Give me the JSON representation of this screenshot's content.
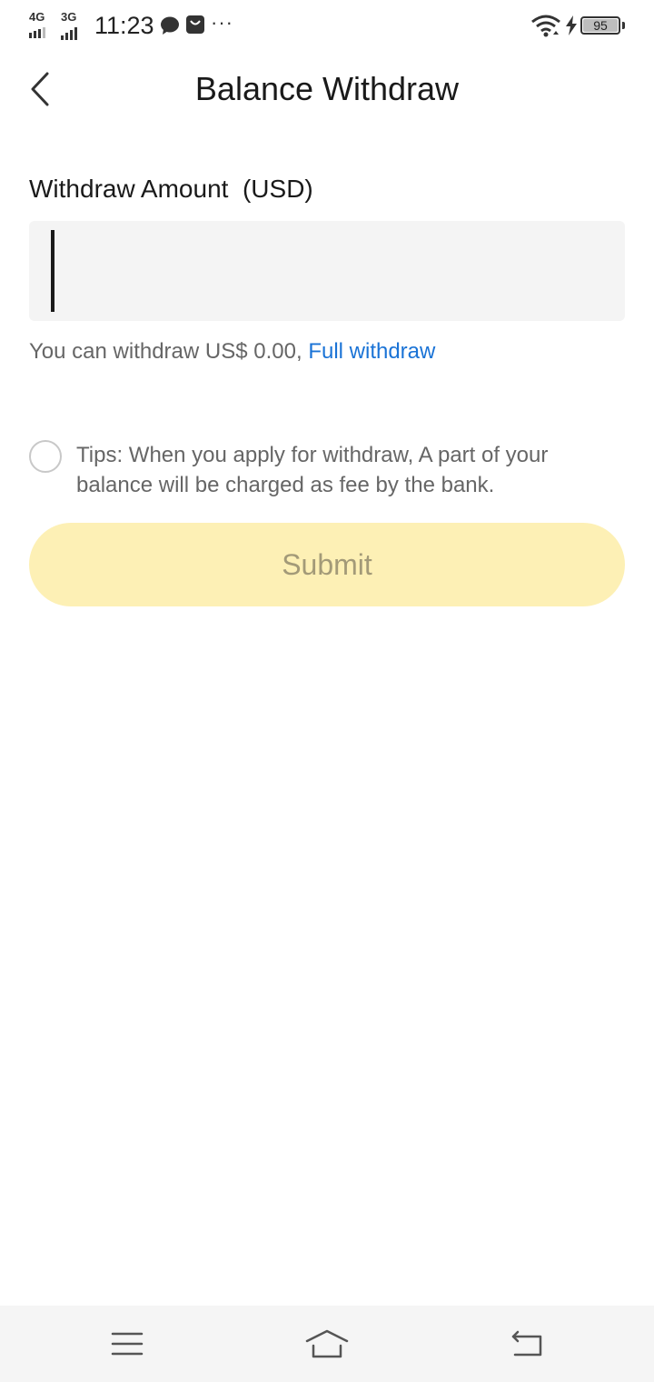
{
  "status_bar": {
    "network_1": "4G",
    "network_2": "3G",
    "time": "11:23",
    "more_indicator": "···",
    "battery_level": "95",
    "icons": [
      "chat-bubble-icon",
      "shopping-bag-icon",
      "wifi-icon",
      "charging-icon",
      "battery-icon"
    ]
  },
  "header": {
    "back_icon": "chevron-left-icon",
    "title": "Balance Withdraw"
  },
  "form": {
    "label": "Withdraw Amount  (USD)",
    "amount_value": "",
    "available_text": "You can withdraw US$ 0.00, ",
    "full_withdraw_link": "Full withdraw",
    "tips": "Tips: When you apply for withdraw, A part of your balance will be charged as fee by the bank.",
    "submit_label": "Submit"
  },
  "colors": {
    "link": "#1a73d6",
    "submit_bg": "#fdf0b5",
    "submit_text": "#a39a78",
    "input_bg": "#f4f4f4"
  },
  "nav_bar": {
    "icons": [
      "menu-icon",
      "home-icon",
      "back-icon"
    ]
  }
}
